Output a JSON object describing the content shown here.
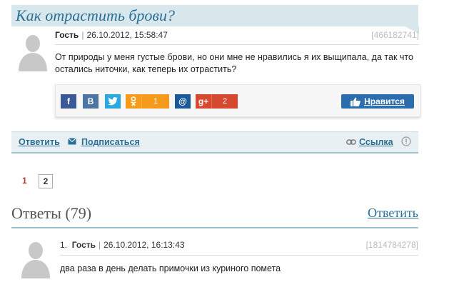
{
  "question": {
    "title": "Как отрастить брови?",
    "author": "Гость",
    "date": "26.10.2012, 15:58:47",
    "id": "[466182741]",
    "text": "От природы у меня густые брови, но они мне не нравились я их выщипала, да так что остались ниточки, как теперь их отрастить?"
  },
  "share": {
    "ok_count": "1",
    "gplus_count": "2",
    "like_label": "Нравится"
  },
  "actions": {
    "reply": "Ответить",
    "subscribe": "Подписаться",
    "link": "Ссылка"
  },
  "pagination": {
    "page1": "1",
    "page2": "2"
  },
  "answers": {
    "title": "Ответы (79)",
    "reply": "Ответить",
    "items": [
      {
        "num": "1.",
        "author": "Гость",
        "date": "26.10.2012, 16:13:43",
        "id": "[1814784278]",
        "text": "два раза в день делать примочки из куриного помета"
      }
    ]
  },
  "colors": {
    "accent": "#2a6f97",
    "title_bg": "#d7e7ec",
    "like_bg": "#2b6dad",
    "fb": "#3b5998",
    "vk": "#4c75a3",
    "tw": "#2aa9e0",
    "ok": "#f59a1b",
    "mail": "#1a5a9a",
    "gplus": "#d6492f"
  }
}
